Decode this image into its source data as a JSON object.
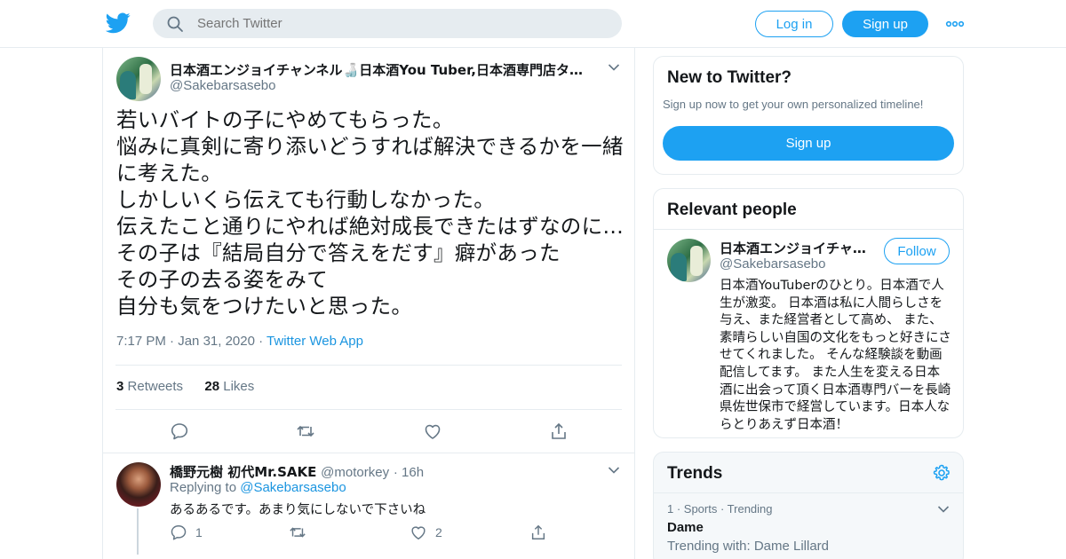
{
  "header": {
    "search_placeholder": "Search Twitter",
    "login_label": "Log in",
    "signup_label": "Sign up",
    "brand_color": "#1da1f2"
  },
  "tweet": {
    "display_name": "日本酒エンジョイチャンネル🍶日本酒You Tuber,日本酒専門店タイ…",
    "handle": "@Sakebarsasebo",
    "text": "若いバイトの子にやめてもらった。\n悩みに真剣に寄り添いどうすれば解決できるかを一緒に考えた。\nしかしいくら伝えても行動しなかった。\n伝えたこと通りにやれば絶対成長できたはずなのに…\nその子は『結局自分で答えをだす』癖があった\nその子の去る姿をみて\n自分も気をつけたいと思った。",
    "time": "7:17 PM",
    "date": "Jan 31, 2020",
    "source": "Twitter Web App",
    "retweets_count": "3",
    "retweets_label": "Retweets",
    "likes_count": "28",
    "likes_label": "Likes"
  },
  "reply": {
    "display_name": "橋野元樹 初代Mr.SAKE",
    "handle": "@motorkey",
    "age": "16h",
    "replying_to_label": "Replying to",
    "replying_to_handle": "@Sakebarsasebo",
    "text": "あるあるです。あまり気にしないで下さいね",
    "reply_count": "1",
    "like_count": "2"
  },
  "sidebar": {
    "new_to_twitter": {
      "title": "New to Twitter?",
      "subtitle": "Sign up now to get your own personalized timeline!",
      "signup_label": "Sign up"
    },
    "relevant_people": {
      "title": "Relevant people",
      "name": "日本酒エンジョイチャ…",
      "handle": "@Sakebarsasebo",
      "follow_label": "Follow",
      "bio": "日本酒YouTuberのひとり。日本酒で人生が激変。 日本酒は私に人間らしさを与え、また経営者として高め、 また、素晴らしい自国の文化をもっと好きにさせてくれました。 そんな経験談を動画配信してます。 また人生を変える日本酒に出会って頂く日本酒専門バーを長崎県佐世保市で経営しています。日本人ならとりあえず日本酒！"
    },
    "trends": {
      "title": "Trends",
      "items": [
        {
          "meta": "1 · Sports · Trending",
          "name": "Dame",
          "with": "Trending with: Dame Lillard"
        }
      ]
    }
  }
}
